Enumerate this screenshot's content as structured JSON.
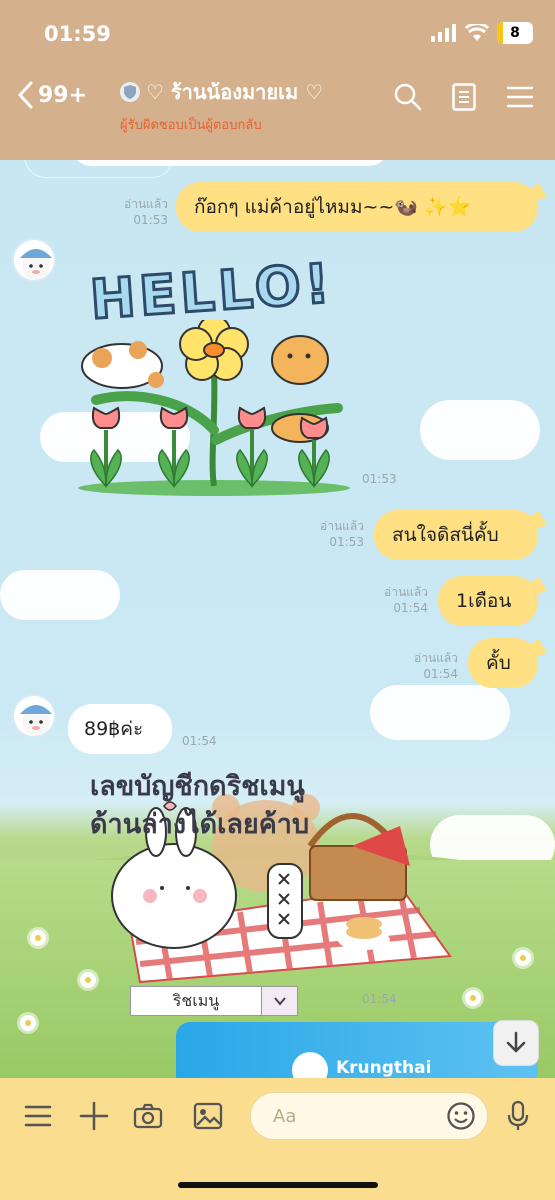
{
  "status": {
    "time": "01:59",
    "battery": "8"
  },
  "header": {
    "back_count": "99+",
    "title": "♡ ร้านน้องมายเม ♡",
    "subtitle": "ผู้รับผิดชอบเป็นผู้ตอบกลับ"
  },
  "messages": [
    {
      "from": "me",
      "text": "ก๊อกๆ แม่ค้าอยู่ไหมม~~🦦 ✨⭐",
      "read": "อ่านแล้ว",
      "time": "01:53"
    },
    {
      "from": "other",
      "type": "sticker",
      "sticker_text": "HELLO!",
      "time": "01:53"
    },
    {
      "from": "me",
      "text": "สนใจดิสนี่คั้บ",
      "read": "อ่านแล้ว",
      "time": "01:53"
    },
    {
      "from": "me",
      "text": "1เดือน",
      "read": "อ่านแล้ว",
      "time": "01:54"
    },
    {
      "from": "me",
      "text": "คั้บ",
      "read": "อ่านแล้ว",
      "time": "01:54"
    },
    {
      "from": "other",
      "text": "89฿ค่ะ",
      "time": "01:54"
    },
    {
      "from": "other",
      "type": "image",
      "line1": "เลขบัญชีกดริชเมนู",
      "line2": "ด้านล่างได้เลยค้าบ",
      "menu_label": "ริชเมนู",
      "time": "01:54"
    },
    {
      "from": "other",
      "type": "image",
      "bank": "Krungthai"
    }
  ],
  "input": {
    "placeholder": "Aa"
  },
  "colors": {
    "header": "#d5b08c",
    "my_bubble": "#ffe083",
    "input_bar": "#fbdd90",
    "subtitle": "#e6622f"
  }
}
